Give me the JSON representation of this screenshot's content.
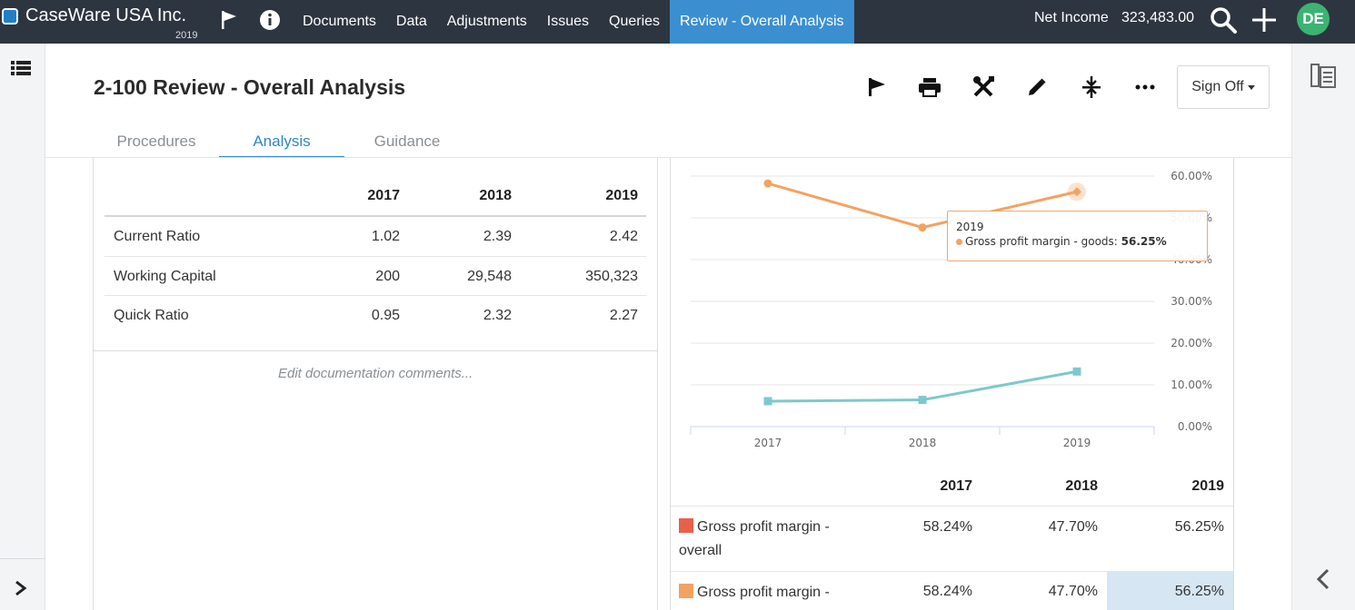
{
  "app": {
    "company": "CaseWare USA Inc.",
    "year": "2019",
    "nav": [
      "Documents",
      "Data",
      "Adjustments",
      "Issues",
      "Queries",
      "Review - Overall Analysis"
    ],
    "net_income_label": "Net Income",
    "net_income_value": "323,483.00",
    "avatar": "DE",
    "icons": [
      "flag-icon",
      "info-icon",
      "search-icon",
      "plus-icon"
    ]
  },
  "page": {
    "title": "2-100 Review - Overall Analysis",
    "signoff": "Sign Off",
    "tabs": [
      "Procedures",
      "Analysis",
      "Guidance"
    ],
    "toolbar_icons": [
      "flag-icon",
      "print-icon",
      "tools-icon",
      "edit-icon",
      "collapse-icon",
      "more-icon"
    ]
  },
  "ratios": {
    "years": [
      "2017",
      "2018",
      "2019"
    ],
    "rows": [
      {
        "label": "Current Ratio",
        "values": [
          "1.02",
          "2.39",
          "2.42"
        ]
      },
      {
        "label": "Working Capital",
        "values": [
          "200",
          "29,548",
          "350,323"
        ]
      },
      {
        "label": "Quick Ratio",
        "values": [
          "0.95",
          "2.32",
          "2.27"
        ]
      }
    ],
    "comments_placeholder": "Edit documentation comments..."
  },
  "chart_data": {
    "type": "line",
    "x": [
      "2017",
      "2018",
      "2019"
    ],
    "ylim": [
      0,
      60
    ],
    "yticks": [
      "0.00%",
      "10.00%",
      "20.00%",
      "30.00%",
      "40.00%",
      "50.00%",
      "60.00%"
    ],
    "series": [
      {
        "name": "Gross profit margin - goods",
        "color": "#f4a261",
        "values": [
          58.24,
          47.7,
          56.25
        ]
      },
      {
        "color": "#7ec8cc",
        "values": [
          6.1,
          6.4,
          13.2
        ]
      }
    ],
    "tooltip": {
      "x": "2019",
      "series": "Gross profit margin - goods",
      "value": "56.25%"
    }
  },
  "growth_table": {
    "years": [
      "2017",
      "2018",
      "2019"
    ],
    "rows": [
      {
        "label_line1": "Gross profit margin -",
        "label_line2": "overall",
        "color": "#e8604c",
        "values": [
          "58.24%",
          "47.70%",
          "56.25%"
        ]
      },
      {
        "label_line1": "Gross profit margin -",
        "color": "#f4a261",
        "values": [
          "58.24%",
          "47.70%",
          "56.25%"
        ]
      }
    ]
  }
}
